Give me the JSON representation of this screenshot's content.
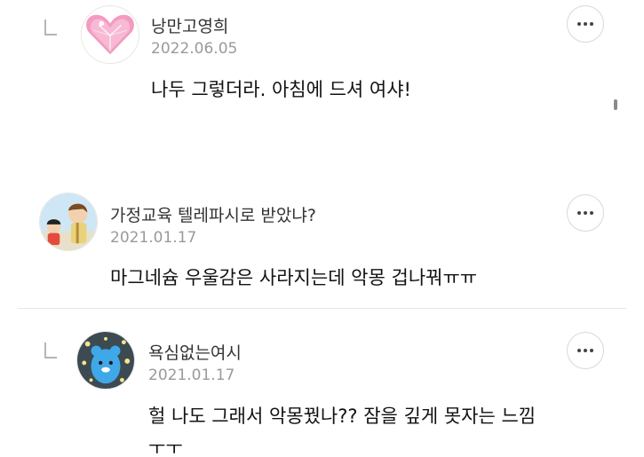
{
  "comments": [
    {
      "nickname": "낭만고영희",
      "date": "2022.06.05",
      "text": "나두 그렇더라. 아침에 드셔 여샤!",
      "is_reply": true,
      "avatar_icon": "pink-heart-gem-avatar"
    },
    {
      "nickname": "가정교육 텔레파시로 받았냐?",
      "date": "2021.01.17",
      "text": "마그네슘 우울감은 사라지는데 악몽 겁나꿔ㅠㅠ",
      "is_reply": false,
      "avatar_icon": "cartoon-characters-avatar"
    },
    {
      "nickname": "욕심없는여시",
      "date": "2021.01.17",
      "text_line1": "헐 나도 그래서 악몽꿨나?? 잠을 깊게 못자는 느낌",
      "text_line2": "ㅜㅜ",
      "is_reply": true,
      "avatar_icon": "blue-character-avatar"
    }
  ],
  "more_icon": "more-horizontal-icon",
  "colors": {
    "nickname": "#333333",
    "date": "#9a9a9a",
    "body": "#111111",
    "divider": "#e8e8e8"
  }
}
